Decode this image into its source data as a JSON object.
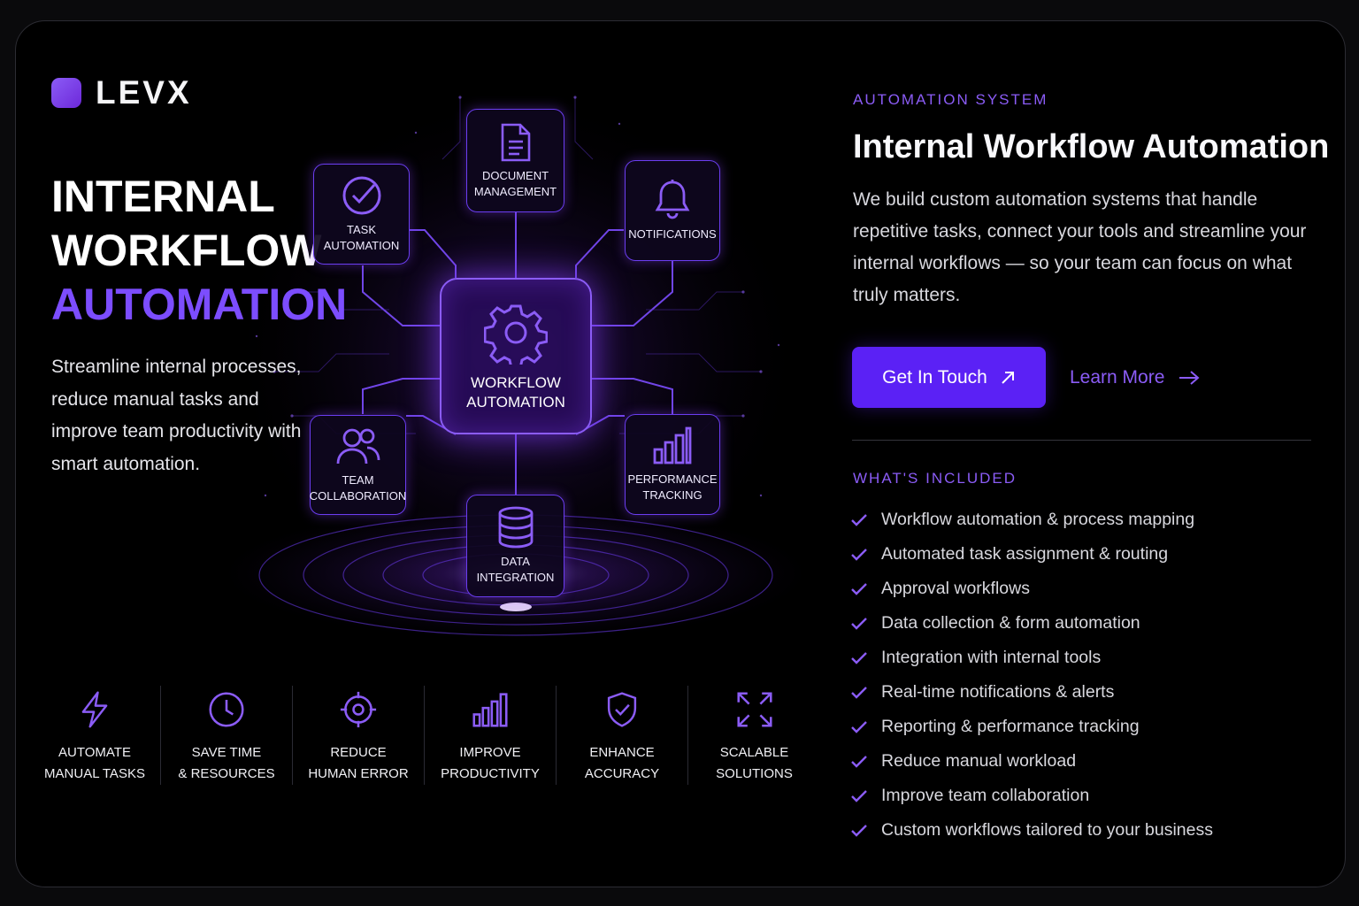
{
  "brand": {
    "name": "LEVX"
  },
  "hero": {
    "title_line1": "INTERNAL",
    "title_line2": "WORKFLOW",
    "title_line3": "AUTOMATION",
    "subtitle": "Streamline internal processes, reduce manual tasks and improve team productivity with smart automation."
  },
  "diagram": {
    "hub": {
      "label": "WORKFLOW\nAUTOMATION",
      "icon": "gear-icon"
    },
    "nodes": [
      {
        "label": "DOCUMENT\nMANAGEMENT",
        "icon": "document-icon"
      },
      {
        "label": "TASK\nAUTOMATION",
        "icon": "check-circle-icon"
      },
      {
        "label": "NOTIFICATIONS",
        "icon": "bell-icon"
      },
      {
        "label": "TEAM\nCOLLABORATION",
        "icon": "users-icon"
      },
      {
        "label": "PERFORMANCE\nTRACKING",
        "icon": "bar-chart-icon"
      },
      {
        "label": "DATA\nINTEGRATION",
        "icon": "database-icon"
      }
    ]
  },
  "benefits": [
    {
      "label": "AUTOMATE\nMANUAL TASKS",
      "icon": "lightning-icon"
    },
    {
      "label": "SAVE TIME\n& RESOURCES",
      "icon": "clock-icon"
    },
    {
      "label": "REDUCE\nHUMAN ERROR",
      "icon": "target-icon"
    },
    {
      "label": "IMPROVE\nPRODUCTIVITY",
      "icon": "bar-chart-icon"
    },
    {
      "label": "ENHANCE\nACCURACY",
      "icon": "shield-check-icon"
    },
    {
      "label": "SCALABLE\nSOLUTIONS",
      "icon": "expand-icon"
    }
  ],
  "panel": {
    "kicker": "AUTOMATION SYSTEM",
    "title": "Internal Workflow Automation",
    "description": "We build custom automation systems that handle repetitive tasks, connect your tools and streamline your internal workflows — so your team can focus on what truly matters.",
    "primary_button": "Get In Touch",
    "secondary_button": "Learn More",
    "included_heading": "WHAT'S INCLUDED",
    "included": [
      "Workflow automation & process mapping",
      "Automated task assignment & routing",
      "Approval workflows",
      "Data collection & form automation",
      "Integration with internal tools",
      "Real-time notifications & alerts",
      "Reporting & performance tracking",
      "Reduce manual workload",
      "Improve team collaboration",
      "Custom workflows tailored to your business"
    ]
  },
  "colors": {
    "accent": "#7c4dff",
    "button": "#5b21f5",
    "background": "#000000",
    "kicker": "#8b5cf6"
  }
}
